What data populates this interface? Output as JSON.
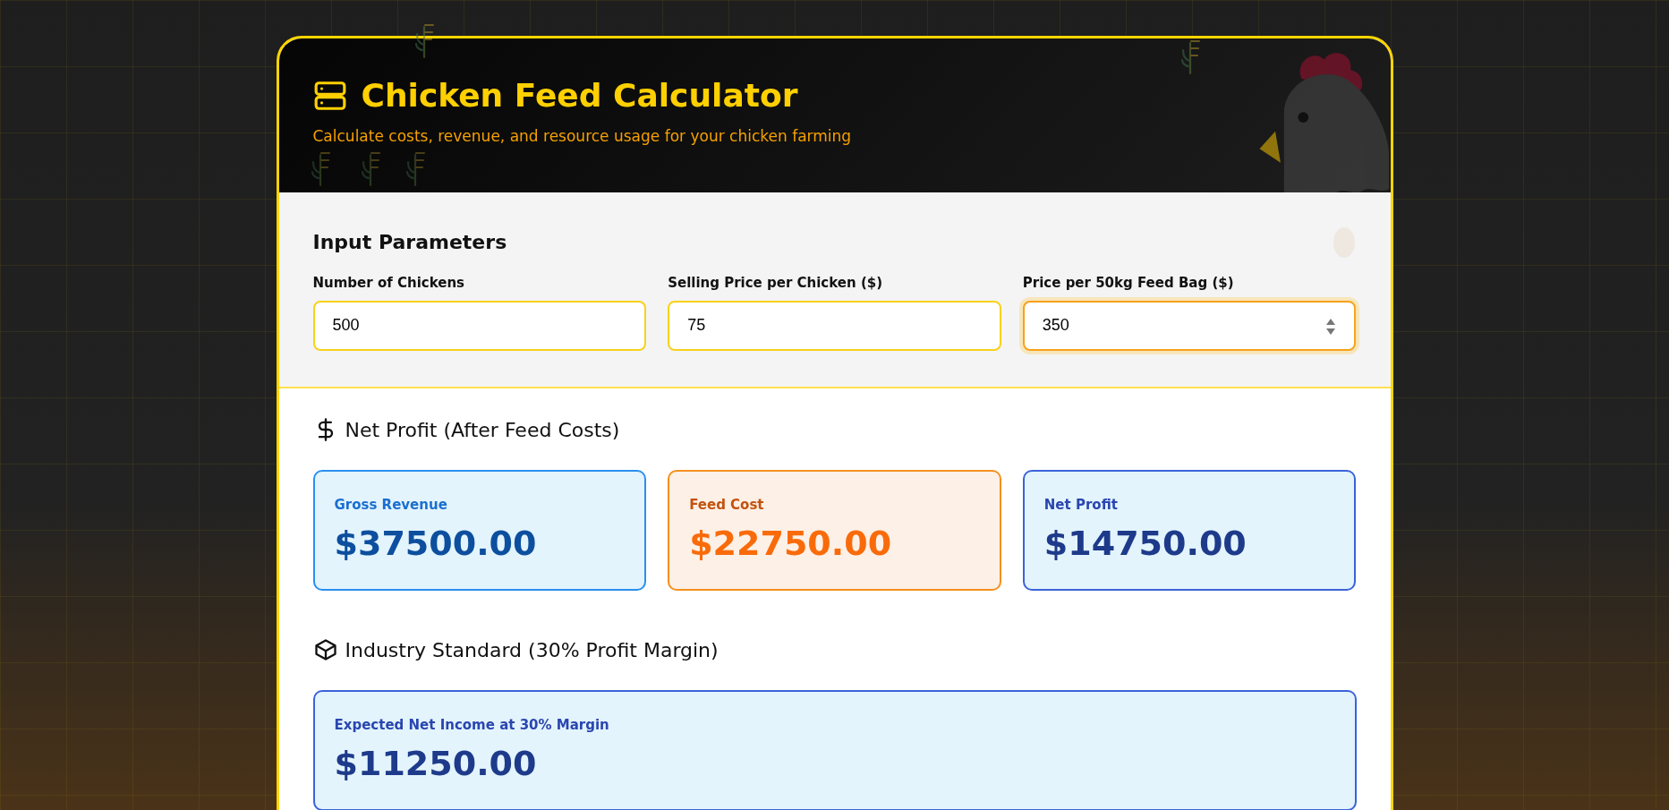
{
  "header": {
    "title": "Chicken Feed Calculator",
    "subtitle": "Calculate costs, revenue, and resource usage for your chicken farming"
  },
  "inputs": {
    "title": "Input Parameters",
    "fields": [
      {
        "label": "Number of Chickens",
        "value": "500",
        "focused": false
      },
      {
        "label": "Selling Price per Chicken ($)",
        "value": "75",
        "focused": false
      },
      {
        "label": "Price per 50kg Feed Bag ($)",
        "value": "350",
        "focused": true
      }
    ]
  },
  "net_profit": {
    "title": "Net Profit (After Feed Costs)",
    "cards": [
      {
        "label": "Gross Revenue",
        "value": "$37500.00",
        "kind": "revenue"
      },
      {
        "label": "Feed Cost",
        "value": "$22750.00",
        "kind": "cost"
      },
      {
        "label": "Net Profit",
        "value": "$14750.00",
        "kind": "profit"
      }
    ]
  },
  "industry": {
    "title": "Industry Standard (30% Profit Margin)",
    "cards": [
      {
        "label": "Expected Net Income at 30% Margin",
        "value": "$11250.00",
        "kind": "profit"
      }
    ]
  }
}
